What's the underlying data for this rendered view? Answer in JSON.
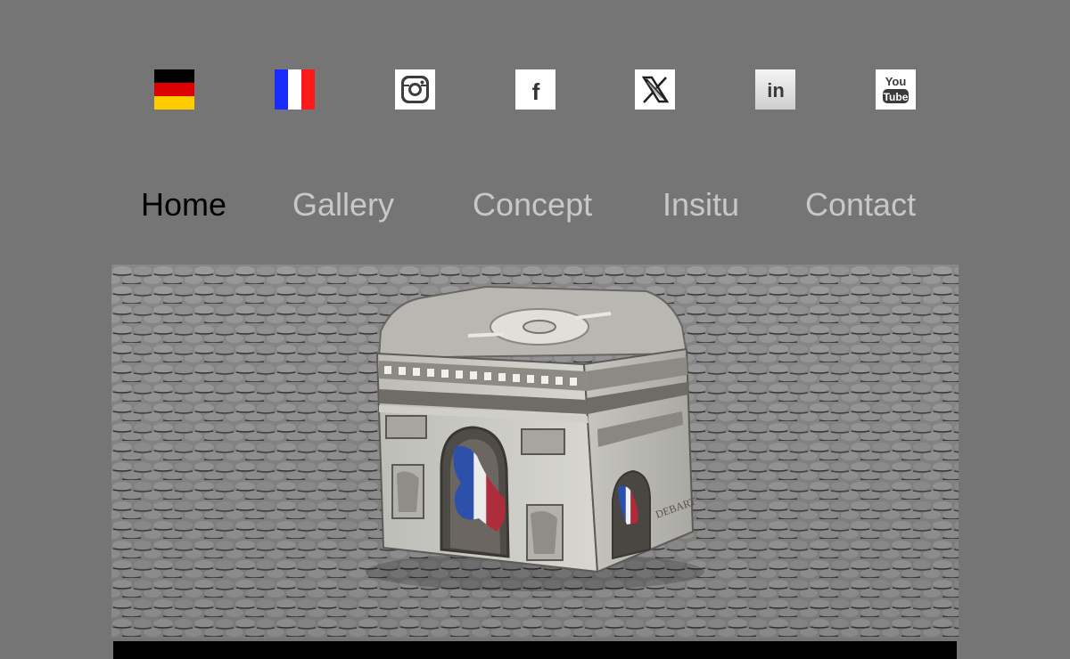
{
  "header": {
    "icons": [
      {
        "name": "flag-germany-icon",
        "label": "Deutsch"
      },
      {
        "name": "flag-france-icon",
        "label": "Français"
      },
      {
        "name": "instagram-icon",
        "label": "Instagram"
      },
      {
        "name": "facebook-icon",
        "label": "Facebook"
      },
      {
        "name": "x-twitter-icon",
        "label": "X"
      },
      {
        "name": "linkedin-icon",
        "label": "LinkedIn"
      },
      {
        "name": "youtube-icon",
        "label": "YouTube"
      }
    ],
    "linkedin_text": "in",
    "youtube_top": "You",
    "youtube_bottom": "Tube",
    "facebook_text": "f"
  },
  "nav": {
    "items": [
      {
        "label": "Home",
        "active": true
      },
      {
        "label": "Gallery",
        "active": false
      },
      {
        "label": "Concept",
        "active": false
      },
      {
        "label": "Insitu",
        "active": false
      },
      {
        "label": "Contact",
        "active": false
      }
    ]
  },
  "hero": {
    "subject": "Arc de Triomphe sculpture on cobblestones"
  },
  "colors": {
    "background": "#757575",
    "nav_inactive": "#c8c8c8",
    "nav_active": "#000000"
  }
}
